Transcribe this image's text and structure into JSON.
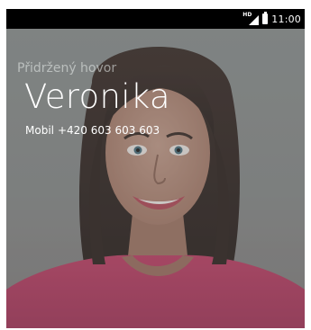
{
  "status_bar": {
    "time": "11:00",
    "network_label": "HD",
    "icons": [
      "hd-badge-icon",
      "signal-icon",
      "battery-icon"
    ]
  },
  "call": {
    "status_label": "Přidržený hovor",
    "caller_name": "Veronika",
    "phone_type": "Mobil",
    "phone_number": "+420 603 603 603"
  },
  "colors": {
    "status_bar_bg": "#000000",
    "overlay_text": "#ffffff",
    "background": "#8a8f8e",
    "shirt": "#b93b62"
  }
}
